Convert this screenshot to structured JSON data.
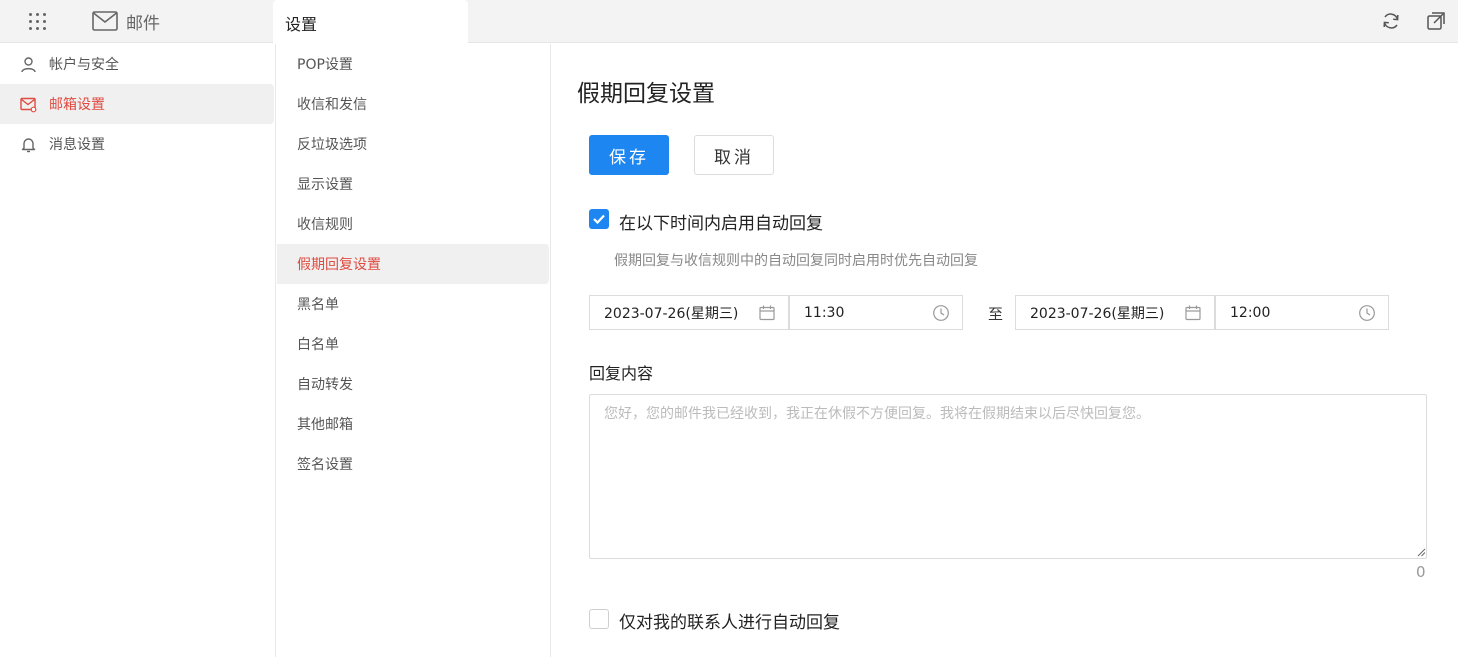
{
  "topbar": {
    "app_name": "邮件",
    "active_tab": "设置"
  },
  "left_nav": {
    "items": [
      {
        "label": "帐户与安全"
      },
      {
        "label": "邮箱设置"
      },
      {
        "label": "消息设置"
      }
    ],
    "active": "邮箱设置"
  },
  "sub_nav": {
    "items": [
      {
        "label": "POP设置"
      },
      {
        "label": "收信和发信"
      },
      {
        "label": "反垃圾选项"
      },
      {
        "label": "显示设置"
      },
      {
        "label": "收信规则"
      },
      {
        "label": "假期回复设置"
      },
      {
        "label": "黑名单"
      },
      {
        "label": "白名单"
      },
      {
        "label": "自动转发"
      },
      {
        "label": "其他邮箱"
      },
      {
        "label": "签名设置"
      }
    ],
    "active": "假期回复设置"
  },
  "main": {
    "title": "假期回复设置",
    "save_label": "保存",
    "cancel_label": "取消",
    "enable_auto_reply": {
      "checked": true,
      "label": "在以下时间内启用自动回复"
    },
    "hint": "假期回复与收信规则中的自动回复同时启用时优先自动回复",
    "start_date": "2023-07-26(星期三)",
    "start_time": "11:30",
    "to_label": "至",
    "end_date": "2023-07-26(星期三)",
    "end_time": "12:00",
    "reply_content_label": "回复内容",
    "reply_placeholder": "您好，您的邮件我已经收到，我正在休假不方便回复。我将在假期结束以后尽快回复您。",
    "char_count": "0",
    "contacts_only": {
      "checked": false,
      "label": "仅对我的联系人进行自动回复"
    }
  },
  "colors": {
    "accent": "#1e86f0",
    "active_nav_text": "#e04a3f"
  },
  "icons": [
    "grid-icon",
    "mail-icon",
    "refresh-icon",
    "external-window-icon",
    "user-icon",
    "mailbox-settings-icon",
    "bell-icon",
    "calendar-icon",
    "clock-icon",
    "checkmark-icon"
  ]
}
